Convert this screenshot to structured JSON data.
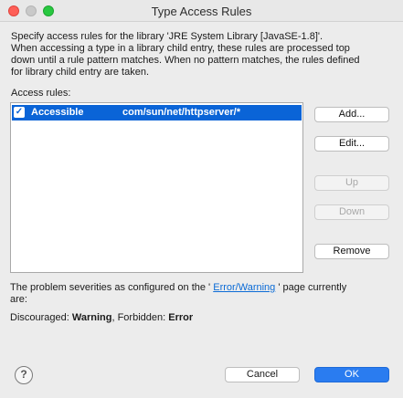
{
  "window": {
    "title": "Type Access Rules"
  },
  "description": {
    "line1": "Specify access rules for the library 'JRE System Library [JavaSE-1.8]'.",
    "line2": "When accessing a type in a library child entry, these rules are processed top",
    "line3": "down until a rule pattern matches. When no pattern matches, the rules defined",
    "line4": "for library child entry are taken."
  },
  "access_rules": {
    "label": "Access rules:",
    "rows": [
      {
        "checked": true,
        "kind": "Accessible",
        "pattern": "com/sun/net/httpserver/*"
      }
    ]
  },
  "buttons": {
    "add": "Add...",
    "edit": "Edit...",
    "up": "Up",
    "down": "Down",
    "remove": "Remove",
    "cancel": "Cancel",
    "ok": "OK"
  },
  "severity": {
    "prefix": "The problem severities as configured on the '",
    "link": "Error/Warning",
    "suffix": "' page currently",
    "line2": "are:"
  },
  "discouraged": {
    "label1": "Discouraged: ",
    "value1": "Warning",
    "label2": ", Forbidden: ",
    "value2": "Error"
  },
  "help": {
    "glyph": "?"
  }
}
